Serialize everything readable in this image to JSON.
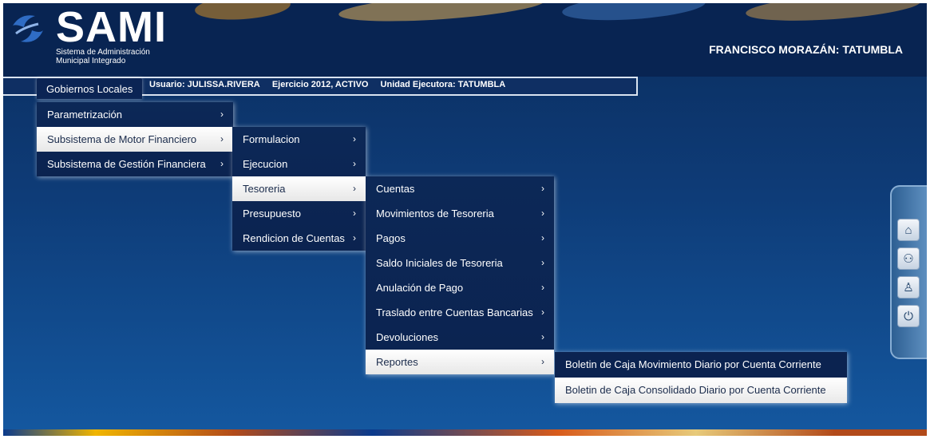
{
  "colors": {
    "header_bg": "#082452",
    "content_bg_top": "#0b2d5e",
    "content_bg_bottom": "#1458a0",
    "menu_bg": "#0b2350",
    "menu_active_bg": "#ffffff",
    "text": "#ffffff"
  },
  "header": {
    "title": "SAMI",
    "subtitle_line1": "Sistema de Administración",
    "subtitle_line2": "Municipal Integrado",
    "municipality": "FRANCISCO MORAZÁN: TATUMBLA",
    "logo_icon": "sami-logo-icon"
  },
  "topbar": {
    "menu_label": "Gobiernos Locales",
    "usuario": "Usuario: JULISSA.RIVERA",
    "ejercicio": "Ejercicio 2012, ACTIVO",
    "unidad": "Unidad Ejecutora: TATUMBLA"
  },
  "menu": {
    "level1": [
      {
        "label": "Parametrización",
        "chev": "›"
      },
      {
        "label": "Subsistema de Motor Financiero",
        "chev": "›"
      },
      {
        "label": "Subsistema de Gestión Financiera",
        "chev": "›"
      }
    ],
    "level2": [
      {
        "label": "Formulacion",
        "chev": "›"
      },
      {
        "label": "Ejecucion",
        "chev": "›"
      },
      {
        "label": "Tesoreria",
        "chev": "›"
      },
      {
        "label": "Presupuesto",
        "chev": "›"
      },
      {
        "label": "Rendicion de Cuentas",
        "chev": "›"
      }
    ],
    "level3": [
      {
        "label": "Cuentas",
        "chev": "›"
      },
      {
        "label": "Movimientos de Tesoreria",
        "chev": "›"
      },
      {
        "label": "Pagos",
        "chev": "›"
      },
      {
        "label": "Saldo Iniciales de Tesoreria",
        "chev": "›"
      },
      {
        "label": "Anulación de Pago",
        "chev": "›"
      },
      {
        "label": "Traslado entre Cuentas Bancarias",
        "chev": "›"
      },
      {
        "label": "Devoluciones",
        "chev": "›"
      },
      {
        "label": "Reportes",
        "chev": "›"
      }
    ],
    "level4": [
      {
        "label": "Boletin de Caja Movimiento Diario por Cuenta Corriente"
      },
      {
        "label": "Boletin de Caja Consolidado Diario por Cuenta Corriente"
      }
    ]
  },
  "dock": {
    "icons": [
      "home-icon",
      "users-icon",
      "user-key-icon",
      "power-icon"
    ],
    "glyphs": [
      "⌂",
      "⚇",
      "♙",
      "⏻"
    ]
  }
}
